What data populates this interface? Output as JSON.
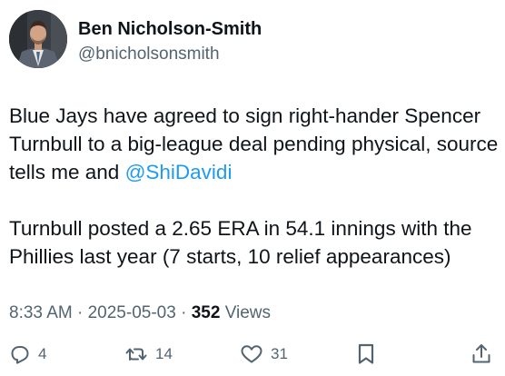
{
  "author": {
    "display_name": "Ben Nicholson-Smith",
    "handle": "@bnicholsonsmith"
  },
  "tweet": {
    "paragraph1_text": "Blue Jays have agreed to sign right-hander Spencer Turnbull to a big-league deal pending physical, source tells me and ",
    "mention": "@ShiDavidi",
    "paragraph2_text": "Turnbull posted a 2.65 ERA in 54.1 innings with the Phillies last year (7 starts, 10 relief appearances)"
  },
  "meta": {
    "time": "8:33 AM",
    "separator": "·",
    "date": "2025-05-03",
    "views_count": "352",
    "views_label": "Views"
  },
  "actions": {
    "replies": "4",
    "reposts": "14",
    "likes": "31"
  },
  "icons": {
    "reply": "reply-icon",
    "repost": "repost-icon",
    "like": "like-icon",
    "bookmark": "bookmark-icon",
    "share": "share-icon"
  },
  "colors": {
    "link": "#1d9bf0",
    "text": "#0f1419",
    "secondary": "#536471"
  }
}
